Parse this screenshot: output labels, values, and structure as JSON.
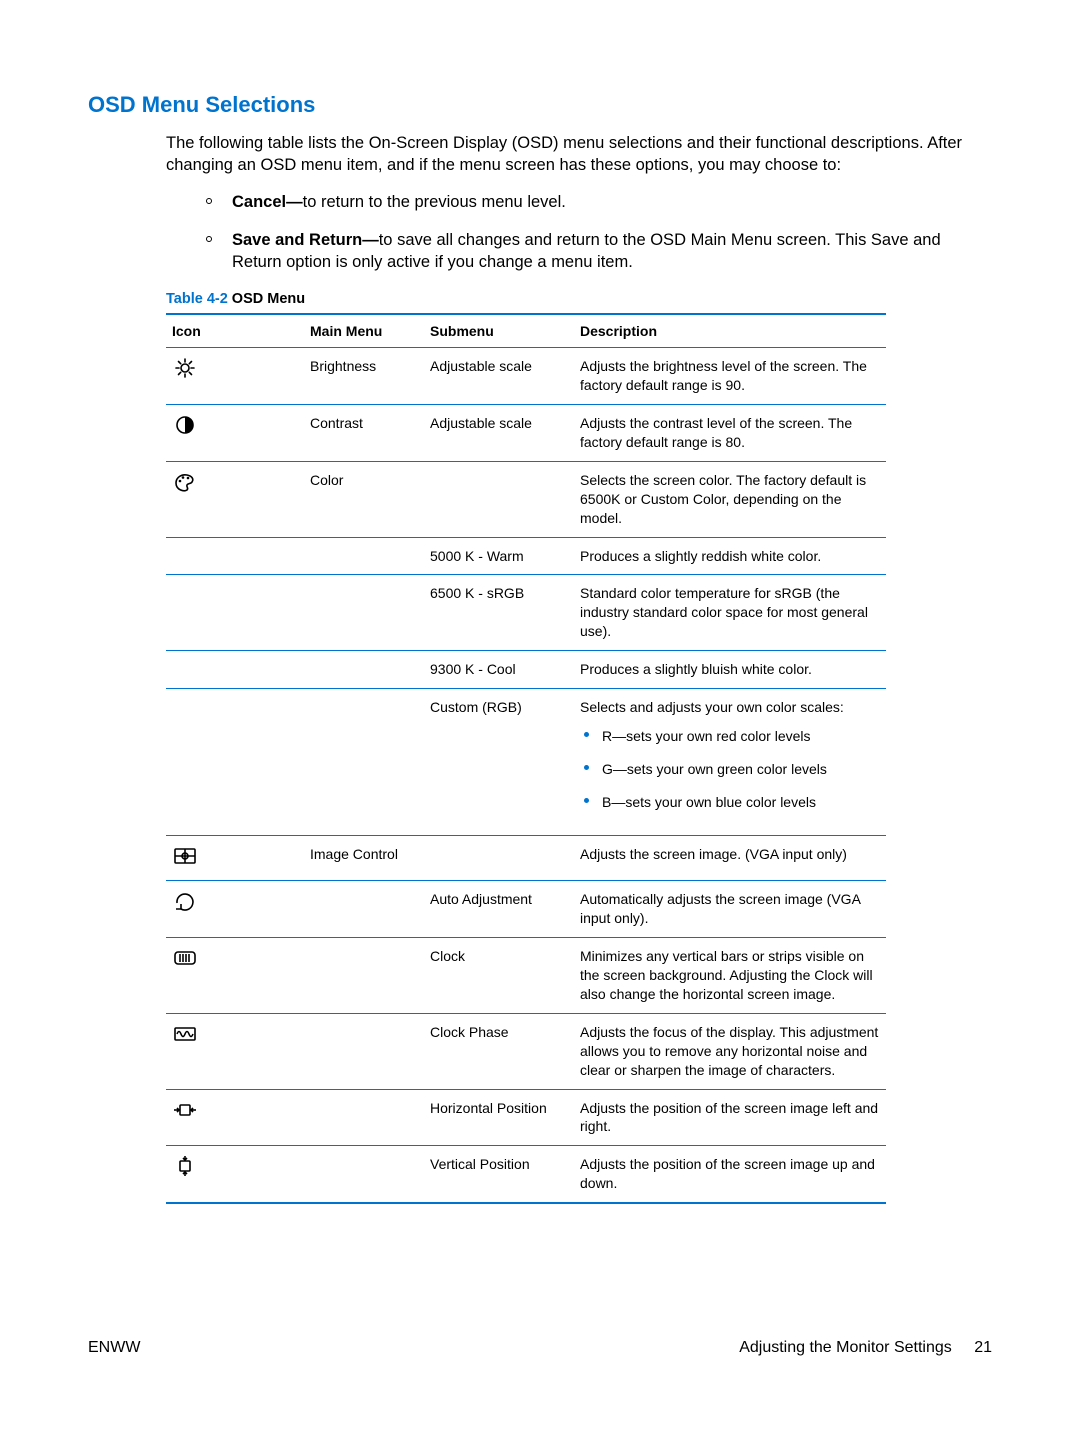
{
  "heading": "OSD Menu Selections",
  "intro": "The following table lists the On-Screen Display (OSD) menu selections and their functional descriptions. After changing an OSD menu item, and if the menu screen has these options, you may choose to:",
  "options": {
    "cancel_bold": "Cancel—",
    "cancel_rest": "to return to the previous menu level.",
    "save_bold": "Save and Return—",
    "save_rest": "to save all changes and return to the OSD Main Menu screen. This Save and Return option is only active if you change a menu item."
  },
  "table_caption": {
    "label": "Table 4-2",
    "name": "  OSD Menu"
  },
  "columns": {
    "icon": "Icon",
    "main": "Main Menu",
    "sub": "Submenu",
    "desc": "Description"
  },
  "rows": {
    "brightness": {
      "main": "Brightness",
      "sub": "Adjustable scale",
      "desc": "Adjusts the brightness level of the screen. The factory default range is 90."
    },
    "contrast": {
      "main": "Contrast",
      "sub": "Adjustable scale",
      "desc": "Adjusts the contrast level of the screen. The factory default range is 80."
    },
    "color": {
      "main": "Color",
      "desc": "Selects the screen color. The factory default is 6500K or Custom Color, depending on the model."
    },
    "c5000": {
      "sub": "5000 K - Warm",
      "desc": "Produces a slightly reddish white color."
    },
    "c6500": {
      "sub": "6500 K - sRGB",
      "desc": "Standard color temperature for sRGB (the industry standard color space for most general use)."
    },
    "c9300": {
      "sub": "9300 K - Cool",
      "desc": "Produces a slightly bluish white color."
    },
    "custom": {
      "sub": "Custom (RGB)",
      "desc": "Selects and adjusts your own color scales:",
      "r": "R—sets your own red color levels",
      "g": "G—sets your own green color levels",
      "b": "B—sets your own blue color levels"
    },
    "image": {
      "main": "Image Control",
      "desc": "Adjusts the screen image. (VGA input only)"
    },
    "auto": {
      "sub": "Auto Adjustment",
      "desc": "Automatically adjusts the screen image (VGA input only)."
    },
    "clock": {
      "sub": "Clock",
      "desc": "Minimizes any vertical bars or strips visible on the screen background. Adjusting the Clock will also change the horizontal screen image."
    },
    "phase": {
      "sub": "Clock Phase",
      "desc": "Adjusts the focus of the display. This adjustment allows you to remove any horizontal noise and clear or sharpen the image of characters."
    },
    "hpos": {
      "sub": "Horizontal Position",
      "desc": "Adjusts the position of the screen image left and right."
    },
    "vpos": {
      "sub": "Vertical Position",
      "desc": "Adjusts the position of the screen image up and down."
    }
  },
  "footer": {
    "left": "ENWW",
    "right": "Adjusting the Monitor Settings",
    "page": "21"
  }
}
